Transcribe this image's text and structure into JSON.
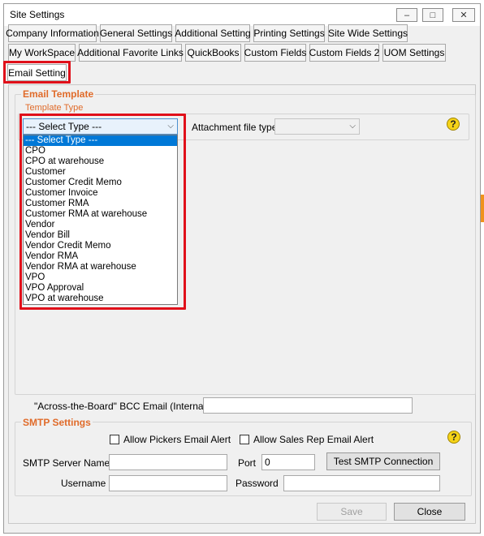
{
  "window": {
    "title": "Site Settings",
    "controls": {
      "minimize": "–",
      "maximize": "□",
      "close": "✕"
    }
  },
  "tabs": {
    "row1": [
      "Company Information",
      "General Settings",
      "Additional Setting",
      "Printing Settings",
      "Site Wide Settings"
    ],
    "row2": [
      "My WorkSpace",
      "Additional Favorite Links",
      "QuickBooks",
      "Custom Fields",
      "Custom Fields 2",
      "UOM Settings"
    ],
    "active": "Email Setting"
  },
  "email_template": {
    "title": "Email Template",
    "template_type_legend": "Template Type",
    "selected_type": "--- Select Type ---",
    "options": [
      "--- Select Type ---",
      "CPO",
      "CPO at warehouse",
      "Customer",
      "Customer Credit Memo",
      "Customer Invoice",
      "Customer RMA",
      "Customer RMA at warehouse",
      "Vendor",
      "Vendor Bill",
      "Vendor Credit Memo",
      "Vendor RMA",
      "Vendor RMA at warehouse",
      "VPO",
      "VPO Approval",
      "VPO at warehouse"
    ],
    "attachment_label": "Attachment file type",
    "attachment_value": ""
  },
  "bcc": {
    "label": "\"Across-the-Board\" BCC Email (Internal)",
    "value": ""
  },
  "smtp": {
    "title": "SMTP Settings",
    "allow_pickers": "Allow Pickers Email Alert",
    "allow_sales_rep": "Allow Sales Rep Email Alert",
    "server_label": "SMTP Server Name",
    "server_value": "",
    "port_label": "Port",
    "port_value": "0",
    "test_button": "Test SMTP Connection",
    "username_label": "Username",
    "username_value": "",
    "password_label": "Password",
    "password_value": ""
  },
  "footer": {
    "save": "Save",
    "close": "Close"
  },
  "help_glyph": "?"
}
